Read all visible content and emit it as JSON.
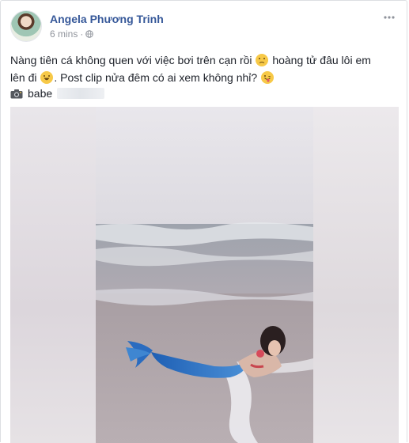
{
  "post": {
    "author": "Angela Phương Trinh",
    "time": "6 mins",
    "separator": "·",
    "text_line1_part1": "Nàng tiên cá không quen với việc bơi trên cạn rồi",
    "text_line1_part2": "hoàng tử đâu lôi em",
    "text_line2_part1": "lên đi",
    "text_line2_part2": ". Post clip nửa đêm có ai xem không nhỉ?",
    "tag_label": "babe"
  },
  "icons": {
    "avatar": "avatar",
    "privacy": "globe-icon",
    "more": "more-options-icon",
    "emoji1": "disappointed-face-icon",
    "emoji2": "tears-of-joy-icon",
    "emoji3": "winking-tongue-face-icon",
    "tag": "camera-icon"
  },
  "colors": {
    "author_link": "#365899",
    "meta_text": "#90949c",
    "body_text": "#1d2129",
    "border": "#dddfe2"
  }
}
